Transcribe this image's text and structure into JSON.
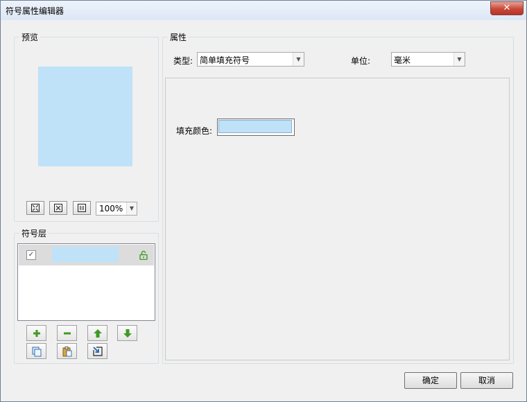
{
  "window": {
    "title": "符号属性编辑器",
    "close_label": "✕"
  },
  "preview": {
    "group_title": "预览",
    "swatch_color": "#bfe2f8",
    "toolbar": {
      "fit_icon": "fit-to-window-icon",
      "zoom_extent_icon": "zoom-extent-icon",
      "actual_size_icon": "actual-size-icon",
      "zoom_value": "100%"
    }
  },
  "layers": {
    "group_title": "符号层",
    "items": [
      {
        "checked": true,
        "check_mark": "✓",
        "color": "#bfe2f8",
        "locked": false
      }
    ],
    "buttons": {
      "add": "add-icon",
      "remove": "remove-icon",
      "move_up": "arrow-up-icon",
      "move_down": "arrow-down-icon",
      "copy": "copy-icon",
      "paste": "paste-icon",
      "import": "import-icon"
    }
  },
  "properties": {
    "group_title": "属性",
    "type_label": "类型:",
    "type_value": "简单填充符号",
    "unit_label": "单位:",
    "unit_value": "毫米",
    "fill_color_label": "填充颜色:",
    "fill_color": "#bfe2f8"
  },
  "footer": {
    "ok_label": "确定",
    "cancel_label": "取消"
  },
  "colors": {
    "accent_green": "#3f9a24",
    "window_bg": "#f0f0f0"
  }
}
